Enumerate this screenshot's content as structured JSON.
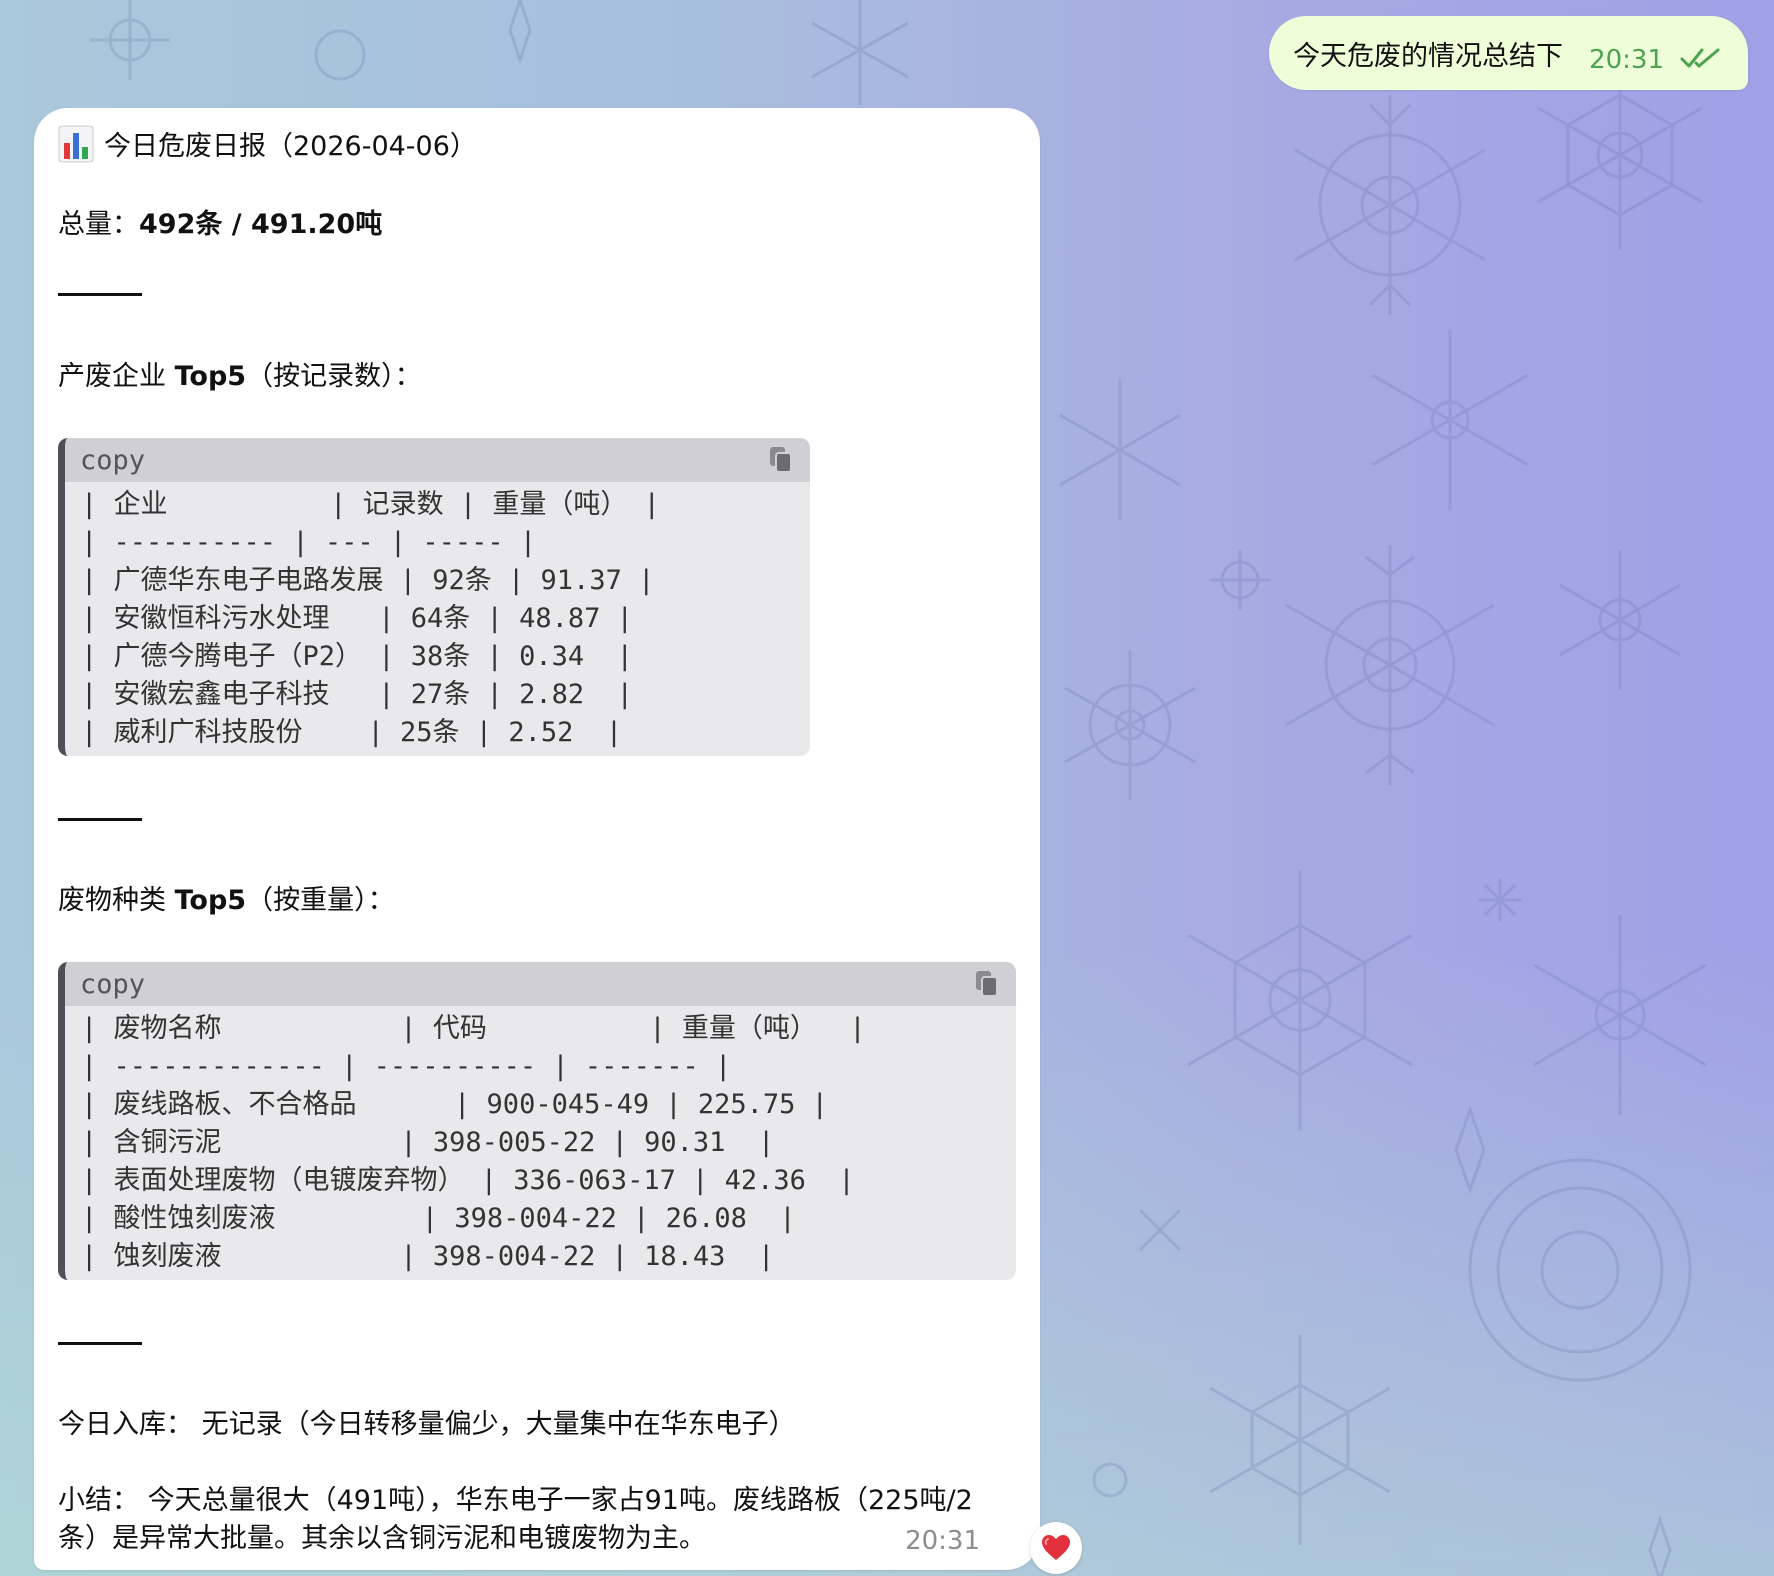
{
  "outgoing": {
    "text": "今天危废的情况总结下",
    "time": "20:31",
    "status_icon": "double-check-icon",
    "bubble_color": "#eefed9",
    "time_color": "#4ea34f"
  },
  "incoming": {
    "title": "今日危废日报（2026-04-06）",
    "title_icon": "bar-chart-emoji",
    "total_label": "总量：",
    "total_value": "492条 / 491.20吨",
    "section1_prefix": "产废企业 ",
    "section1_bold": "Top5",
    "section1_suffix": "（按记录数）：",
    "code1": {
      "lang": "copy",
      "lines": [
        "| 企业          | 记录数 | 重量（吨） |",
        "| ---------- | --- | ----- |",
        "| 广德华东电子电路发展 | 92条 | 91.37 |",
        "| 安徽恒科污水处理   | 64条 | 48.87 |",
        "| 广德今腾电子（P2） | 38条 | 0.34  |",
        "| 安徽宏鑫电子科技   | 27条 | 2.82  |",
        "| 威利广科技股份    | 25条 | 2.52  |"
      ]
    },
    "section2_prefix": "废物种类 ",
    "section2_bold": "Top5",
    "section2_suffix": "（按重量）：",
    "code2": {
      "lang": "copy",
      "lines": [
        "| 废物名称           | 代码          | 重量（吨）  |",
        "| ------------- | ---------- | ------- |",
        "| 废线路板、不合格品      | 900-045-49 | 225.75 |",
        "| 含铜污泥           | 398-005-22 | 90.31  |",
        "| 表面处理废物（电镀废弃物） | 336-063-17 | 42.36  |",
        "| 酸性蚀刻废液         | 398-004-22 | 26.08  |",
        "| 蚀刻废液           | 398-004-22 | 18.43  |"
      ]
    },
    "storage_label": "今日入库：",
    "storage_value": "无记录（今日转移量偏少，大量集中在华东电子）",
    "summary_label": "小结：",
    "summary_line1": "今天总量很大（491吨），华东电子一家占91吨。废线路板（225吨/2",
    "summary_line2": "条）是异常大批量。其余以含铜污泥和电镀废物为主。",
    "time": "20:31",
    "reaction": "❤️",
    "reaction_icon": "heart-icon"
  }
}
